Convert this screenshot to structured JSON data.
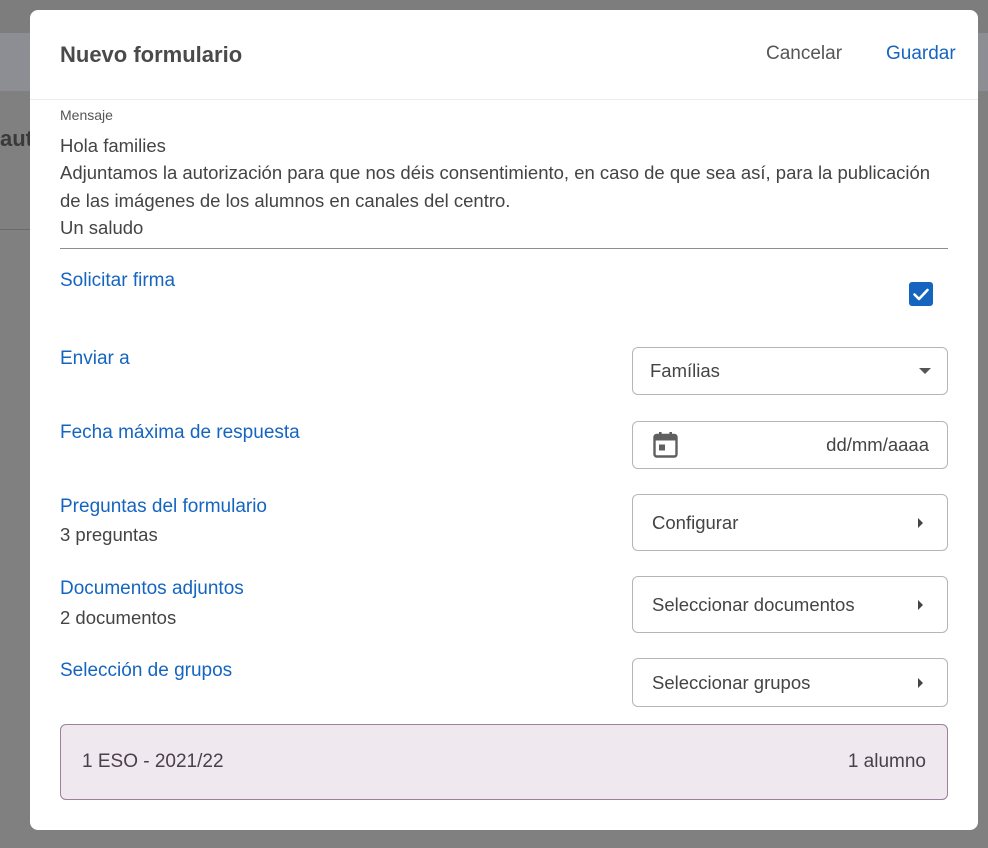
{
  "background": {
    "partial_heading": "aut"
  },
  "modal": {
    "title": "Nuevo formulario",
    "cancel_label": "Cancelar",
    "save_label": "Guardar"
  },
  "message": {
    "label": "Mensaje",
    "lines": [
      "Hola families",
      "Adjuntamos la autorización para que nos déis consentimiento, en caso de que sea así, para la publicación de las imágenes de los alumnos en canales del centro.",
      "Un saludo"
    ]
  },
  "signature": {
    "label": "Solicitar firma",
    "checked": true
  },
  "send_to": {
    "label": "Enviar a",
    "selected": "Famílias"
  },
  "due_date": {
    "label": "Fecha máxima de respuesta",
    "placeholder": "dd/mm/aaaa",
    "icon": "calendar-icon"
  },
  "questions": {
    "label": "Preguntas del formulario",
    "sub": "3 preguntas",
    "button_label": "Configurar"
  },
  "documents": {
    "label": "Documentos adjuntos",
    "sub": "2 documentos",
    "button_label": "Seleccionar documentos"
  },
  "groups": {
    "label": "Selección de grupos",
    "button_label": "Seleccionar grupos",
    "selected": [
      {
        "name": "1 ESO - 2021/22",
        "count": "1 alumno"
      }
    ]
  },
  "colors": {
    "accent": "#1565c0",
    "group_card_bg": "#efe8ef",
    "group_card_border": "#9a829a"
  }
}
